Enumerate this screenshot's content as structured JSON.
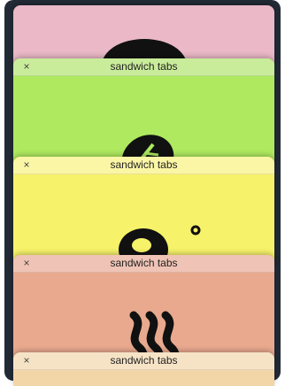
{
  "tabs": [
    {
      "title": "",
      "close_icon": "",
      "colors": {
        "bar": "#ecc4cd",
        "body": "#eab8c6"
      },
      "glyph": "record-icon"
    },
    {
      "title": "sandwich tabs",
      "close_icon": "×",
      "colors": {
        "bar": "#c9ec9a",
        "body": "#aee95f"
      },
      "glyph": "leaf-icon"
    },
    {
      "title": "sandwich tabs",
      "close_icon": "×",
      "colors": {
        "bar": "#fbf6a5",
        "body": "#f6f26a"
      },
      "glyph": "tomato-icon"
    },
    {
      "title": "sandwich tabs",
      "close_icon": "×",
      "colors": {
        "bar": "#efc3b5",
        "body": "#e9a98e"
      },
      "glyph": "bacon-icon"
    },
    {
      "title": "sandwich tabs",
      "close_icon": "×",
      "colors": {
        "bar": "#f6e3c6",
        "body": "#f3d6a8"
      },
      "glyph": ""
    }
  ]
}
